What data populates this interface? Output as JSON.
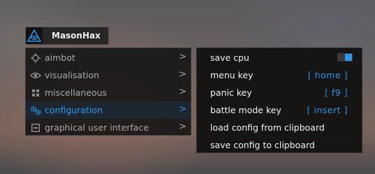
{
  "app": {
    "title": "MasonHax",
    "logo_icon": "eye-triangle-icon"
  },
  "colors": {
    "accent": "#2b95e8",
    "text": "#f2f2f2",
    "muted": "#a9a9a9"
  },
  "menu": {
    "chevron": ">",
    "items": [
      {
        "label": "aimbot",
        "icon": "crosshair-icon",
        "active": false
      },
      {
        "label": "visualisation",
        "icon": "eye-icon",
        "active": false
      },
      {
        "label": "miscellaneous",
        "icon": "grid-icon",
        "active": false
      },
      {
        "label": "configuration",
        "icon": "gears-icon",
        "active": true
      },
      {
        "label": "graphical user interface",
        "icon": "window-icon",
        "active": false
      }
    ]
  },
  "settings": {
    "save_cpu": {
      "label": "save cpu",
      "enabled": true
    },
    "menu_key": {
      "label": "menu key",
      "value": "[ home ]"
    },
    "panic_key": {
      "label": "panic key",
      "value": "[ f9 ]"
    },
    "battle_mode_key": {
      "label": "battle mode key",
      "value": "[ insert ]"
    },
    "load_config": {
      "label": "load config from clipboard"
    },
    "save_config": {
      "label": "save config to clipboard"
    }
  }
}
